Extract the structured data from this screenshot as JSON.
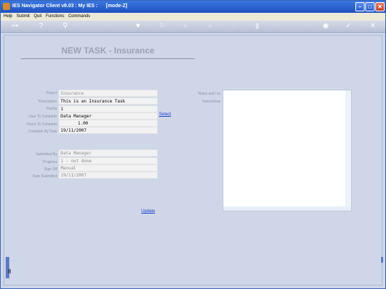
{
  "titlebar": {
    "title": "IES Navigator Client v8.03 : My IES :      [mode-Z]"
  },
  "menu": [
    "Help",
    "Submit",
    "Quit",
    "Functions",
    "Commands"
  ],
  "toolbar": {
    "icons": [
      "home-icon",
      "help-icon",
      "search-icon",
      "heart-icon",
      "refresh-icon",
      "back-icon",
      "forward-icon",
      "tree-icon",
      "card-icon",
      "globe-icon",
      "check-icon",
      "close-icon"
    ]
  },
  "page": {
    "title": "NEW TASK - Insurance"
  },
  "form": {
    "project": {
      "label": "Project",
      "value": "Insurance"
    },
    "description": {
      "label": "*Description",
      "value": "This is an Insurance Task"
    },
    "priority": {
      "label": "Priority",
      "value": "1"
    },
    "user_to_complete": {
      "label": "User To Complete",
      "value": "Data Manager",
      "link": "Select"
    },
    "hours_to_complete": {
      "label": "Hours To Complete",
      "value": "1.00"
    },
    "complete_by_date": {
      "label": "Complete By Date",
      "value": "19/11/2007"
    },
    "submitted_by": {
      "label": "Submitted By",
      "value": "Data Manager"
    },
    "progress": {
      "label": "Progress",
      "value": "1 - not done"
    },
    "sign_off": {
      "label": "Sign Off",
      "value": "Manual"
    },
    "date_submitted": {
      "label": "Date Submitted",
      "value": "19/11/2007"
    },
    "notes_label_1": "Notes and / or",
    "notes_label_2": "Instructions",
    "update_link": "Update"
  },
  "side": {
    "glyph": "8"
  }
}
